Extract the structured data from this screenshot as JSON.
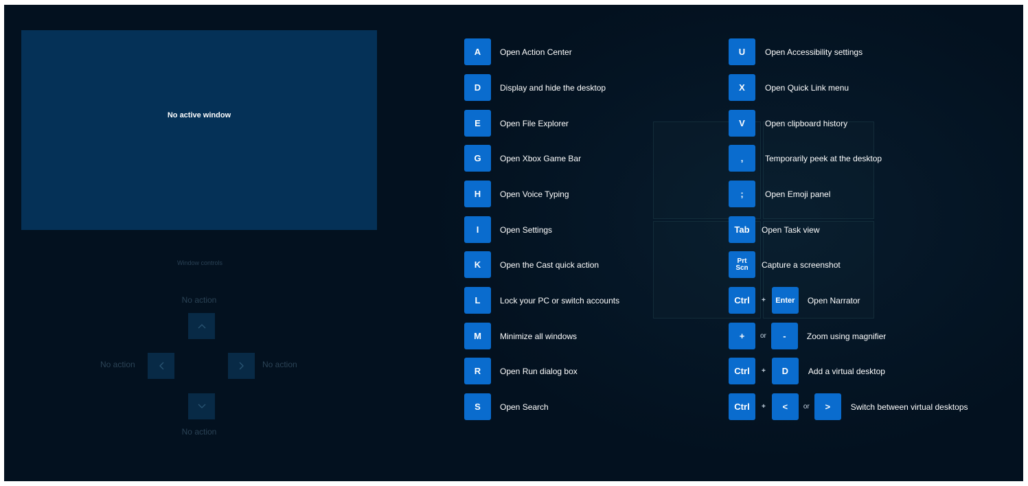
{
  "preview": {
    "text": "No active window"
  },
  "window_controls": {
    "title": "Window controls",
    "up_label": "No action",
    "left_label": "No action",
    "right_label": "No action",
    "down_label": "No action",
    "up_glyph": "^",
    "left_glyph": "<",
    "right_glyph": ">",
    "down_glyph": "v"
  },
  "left_shortcuts": [
    {
      "key": "A",
      "desc": "Open Action Center"
    },
    {
      "key": "D",
      "desc": "Display and hide the desktop"
    },
    {
      "key": "E",
      "desc": "Open File Explorer"
    },
    {
      "key": "G",
      "desc": "Open Xbox Game Bar"
    },
    {
      "key": "H",
      "desc": "Open Voice Typing"
    },
    {
      "key": "I",
      "desc": "Open Settings"
    },
    {
      "key": "K",
      "desc": "Open the Cast quick action"
    },
    {
      "key": "L",
      "desc": "Lock your PC or switch accounts"
    },
    {
      "key": "M",
      "desc": "Minimize all windows"
    },
    {
      "key": "R",
      "desc": "Open Run dialog box"
    },
    {
      "key": "S",
      "desc": "Open Search"
    }
  ],
  "right_shortcuts": {
    "u": {
      "key": "U",
      "desc": "Open Accessibility settings"
    },
    "x": {
      "key": "X",
      "desc": "Open Quick Link menu"
    },
    "v": {
      "key": "V",
      "desc": "Open clipboard history"
    },
    "comma": {
      "key": ",",
      "desc": "Temporarily peek at the desktop"
    },
    "semicolon": {
      "key": ";",
      "desc": "Open Emoji panel"
    },
    "tab": {
      "key": "Tab",
      "desc": "Open Task view"
    },
    "prtscn": {
      "key_line1": "Prt",
      "key_line2": "Scn",
      "desc": "Capture a screenshot"
    },
    "narrator": {
      "key1": "Ctrl",
      "plus": "+",
      "key2": "Enter",
      "desc": "Open Narrator"
    },
    "magnifier": {
      "key1": "+",
      "or": "or",
      "key2": "-",
      "desc": "Zoom using magnifier"
    },
    "vdesktop_add": {
      "key1": "Ctrl",
      "plus": "+",
      "key2": "D",
      "desc": "Add a virtual desktop"
    },
    "vdesktop_switch": {
      "key1": "Ctrl",
      "plus": "+",
      "key2": "<",
      "or": "or",
      "key3": ">",
      "desc": "Switch between virtual desktops"
    }
  },
  "colors": {
    "background": "#03111f",
    "key": "#0a6cce",
    "preview": "#053157"
  }
}
